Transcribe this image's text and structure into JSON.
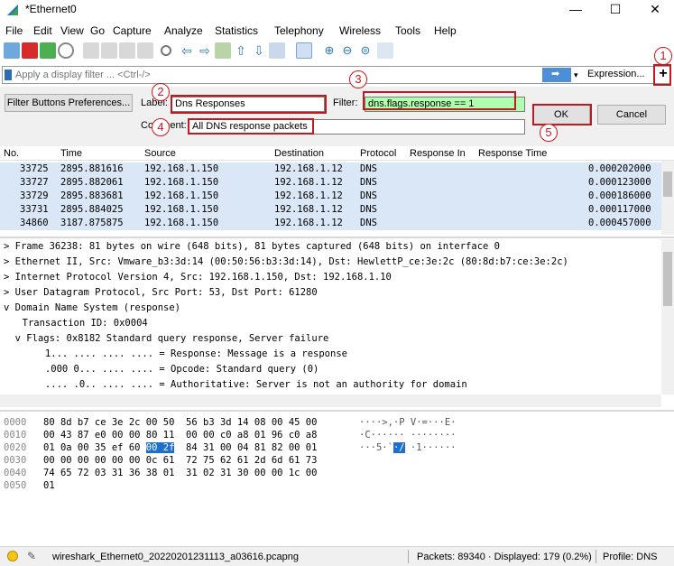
{
  "window": {
    "title": "*Ethernet0",
    "minimize": "—",
    "maximize": "☐",
    "close": "✕"
  },
  "menu": [
    "File",
    "Edit",
    "View",
    "Go",
    "Capture",
    "Analyze",
    "Statistics",
    "Telephony",
    "Wireless",
    "Tools",
    "Help"
  ],
  "filter_bar": {
    "placeholder": "Apply a display filter ... <Ctrl-/>",
    "expression_label": "Expression...",
    "plus_label": "+"
  },
  "filter_buttons": {
    "prefs_label": "Filter Buttons Preferences...",
    "label_caption": "Label:",
    "label_value": "Dns Responses",
    "filter_caption": "Filter:",
    "filter_value": "dns.flags.response == 1",
    "comment_caption": "Comment:",
    "comment_value": "All DNS response packets",
    "ok_label": "OK",
    "cancel_label": "Cancel"
  },
  "annotations": [
    "1",
    "2",
    "3",
    "4",
    "5"
  ],
  "packet_list": {
    "columns": [
      "No.",
      "Time",
      "Source",
      "Destination",
      "Protocol",
      "Response In",
      "Response Time"
    ],
    "rows": [
      {
        "no": "33725",
        "time": "2895.881616",
        "src": "192.168.1.150",
        "dst": "192.168.1.12",
        "proto": "DNS",
        "rtime": "0.000202000"
      },
      {
        "no": "33727",
        "time": "2895.882061",
        "src": "192.168.1.150",
        "dst": "192.168.1.12",
        "proto": "DNS",
        "rtime": "0.000123000"
      },
      {
        "no": "33729",
        "time": "2895.883681",
        "src": "192.168.1.150",
        "dst": "192.168.1.12",
        "proto": "DNS",
        "rtime": "0.000186000"
      },
      {
        "no": "33731",
        "time": "2895.884025",
        "src": "192.168.1.150",
        "dst": "192.168.1.12",
        "proto": "DNS",
        "rtime": "0.000117000"
      },
      {
        "no": "34860",
        "time": "3187.875875",
        "src": "192.168.1.150",
        "dst": "192.168.1.12",
        "proto": "DNS",
        "rtime": "0.000457000"
      }
    ]
  },
  "details": [
    {
      "arrow": ">",
      "text": "Frame 36238: 81 bytes on wire (648 bits), 81 bytes captured (648 bits) on interface 0"
    },
    {
      "arrow": ">",
      "text": "Ethernet II, Src: Vmware_b3:3d:14 (00:50:56:b3:3d:14), Dst: HewlettP_ce:3e:2c (80:8d:b7:ce:3e:2c)"
    },
    {
      "arrow": ">",
      "text": "Internet Protocol Version 4, Src: 192.168.1.150, Dst: 192.168.1.10"
    },
    {
      "arrow": ">",
      "text": "User Datagram Protocol, Src Port: 53, Dst Port: 61280"
    },
    {
      "arrow": "v",
      "text": "Domain Name System (response)"
    },
    {
      "arrow": "",
      "text": "  Transaction ID: 0x0004"
    },
    {
      "arrow": "  v",
      "text": "Flags: 0x8182 Standard query response, Server failure"
    },
    {
      "arrow": "",
      "text": "      1... .... .... .... = Response: Message is a response"
    },
    {
      "arrow": "",
      "text": "      .000 0... .... .... = Opcode: Standard query (0)"
    },
    {
      "arrow": "",
      "text": "      .... .0.. .... .... = Authoritative: Server is not an authority for domain"
    }
  ],
  "hex": [
    {
      "off": "0000",
      "bytes": "80 8d b7 ce 3e 2c 00 50  56 b3 3d 14 08 00 45 00",
      "ascii": "····>,·P V·=···E·"
    },
    {
      "off": "0010",
      "bytes": "00 43 87 e0 00 00 80 11  00 00 c0 a8 01 96 c0 a8",
      "ascii": "·C······ ········"
    },
    {
      "off": "0020",
      "bytes_pre": "01 0a 00 35 ef 60 ",
      "bytes_sel": "00 2f",
      "bytes_post": "  84 31 00 04 81 82 00 01",
      "ascii_pre": "···5·`",
      "ascii_sel": "·/",
      "ascii_post": " ·1······"
    },
    {
      "off": "0030",
      "bytes": "00 00 00 00 00 00 0c 61  72 75 62 61 2d 6d 61 73",
      "ascii": ""
    },
    {
      "off": "0040",
      "bytes": "74 65 72 03 31 36 38 01  31 02 31 30 00 00 1c 00",
      "ascii": ""
    },
    {
      "off": "0050",
      "bytes": "01",
      "ascii": ""
    }
  ],
  "status": {
    "file": "wireshark_Ethernet0_20220201231113_a03616.pcapng",
    "packets": "Packets: 89340 · Displayed: 179 (0.2%)",
    "profile": "Profile: DNS"
  }
}
